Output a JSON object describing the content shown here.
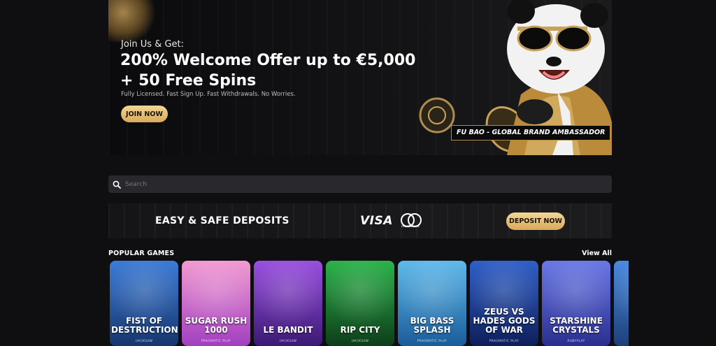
{
  "hero": {
    "kicker": "Join Us & Get:",
    "headline_line1": "200% Welcome Offer up to €5,000",
    "headline_line2": "+ 50 Free Spins",
    "subtext": "Fully Licensed. Fast Sign Up. Fast Withdrawals. No Worries.",
    "cta_label": "JOIN NOW",
    "ambassador_label": "FU BAO - GLOBAL BRAND AMBASSADOR"
  },
  "search": {
    "placeholder": "Search"
  },
  "deposits": {
    "title": "EASY & SAFE DEPOSITS",
    "visa_label": "VISA",
    "mastercard_label": "mastercard",
    "button_label": "DEPOSIT NOW"
  },
  "popular": {
    "title": "POPULAR GAMES",
    "view_all": "View All",
    "games": [
      {
        "name": "FIST OF DESTRUCTION",
        "provider": "HACKSAW",
        "colors": [
          "#3c7bd6",
          "#16366e"
        ]
      },
      {
        "name": "SUGAR RUSH 1000",
        "provider": "PRAGMATIC PLAY",
        "colors": [
          "#f29ad1",
          "#a13fc0"
        ]
      },
      {
        "name": "LE BANDIT",
        "provider": "HACKSAW",
        "colors": [
          "#9a4fe0",
          "#3b1a74"
        ]
      },
      {
        "name": "RIP CITY",
        "provider": "HACKSAW",
        "colors": [
          "#2bb34a",
          "#0d3d1a"
        ]
      },
      {
        "name": "BIG BASS SPLASH",
        "provider": "PRAGMATIC PLAY",
        "colors": [
          "#5fb9ea",
          "#1a5c9a"
        ]
      },
      {
        "name": "ZEUS VS HADES GODS OF WAR",
        "provider": "PRAGMATIC PLAY",
        "colors": [
          "#2f5fc8",
          "#0e1f5a"
        ]
      },
      {
        "name": "STARSHINE CRYSTALS",
        "provider": "RUBYPLAY",
        "colors": [
          "#6a78e6",
          "#2a2f8e"
        ]
      },
      {
        "name": "",
        "provider": "",
        "colors": [
          "#4b8ae0",
          "#1d3f78"
        ]
      }
    ]
  },
  "colors": {
    "background": "#0f0f12",
    "gold_button": "#e4b76a",
    "search_bg": "#28282d"
  }
}
